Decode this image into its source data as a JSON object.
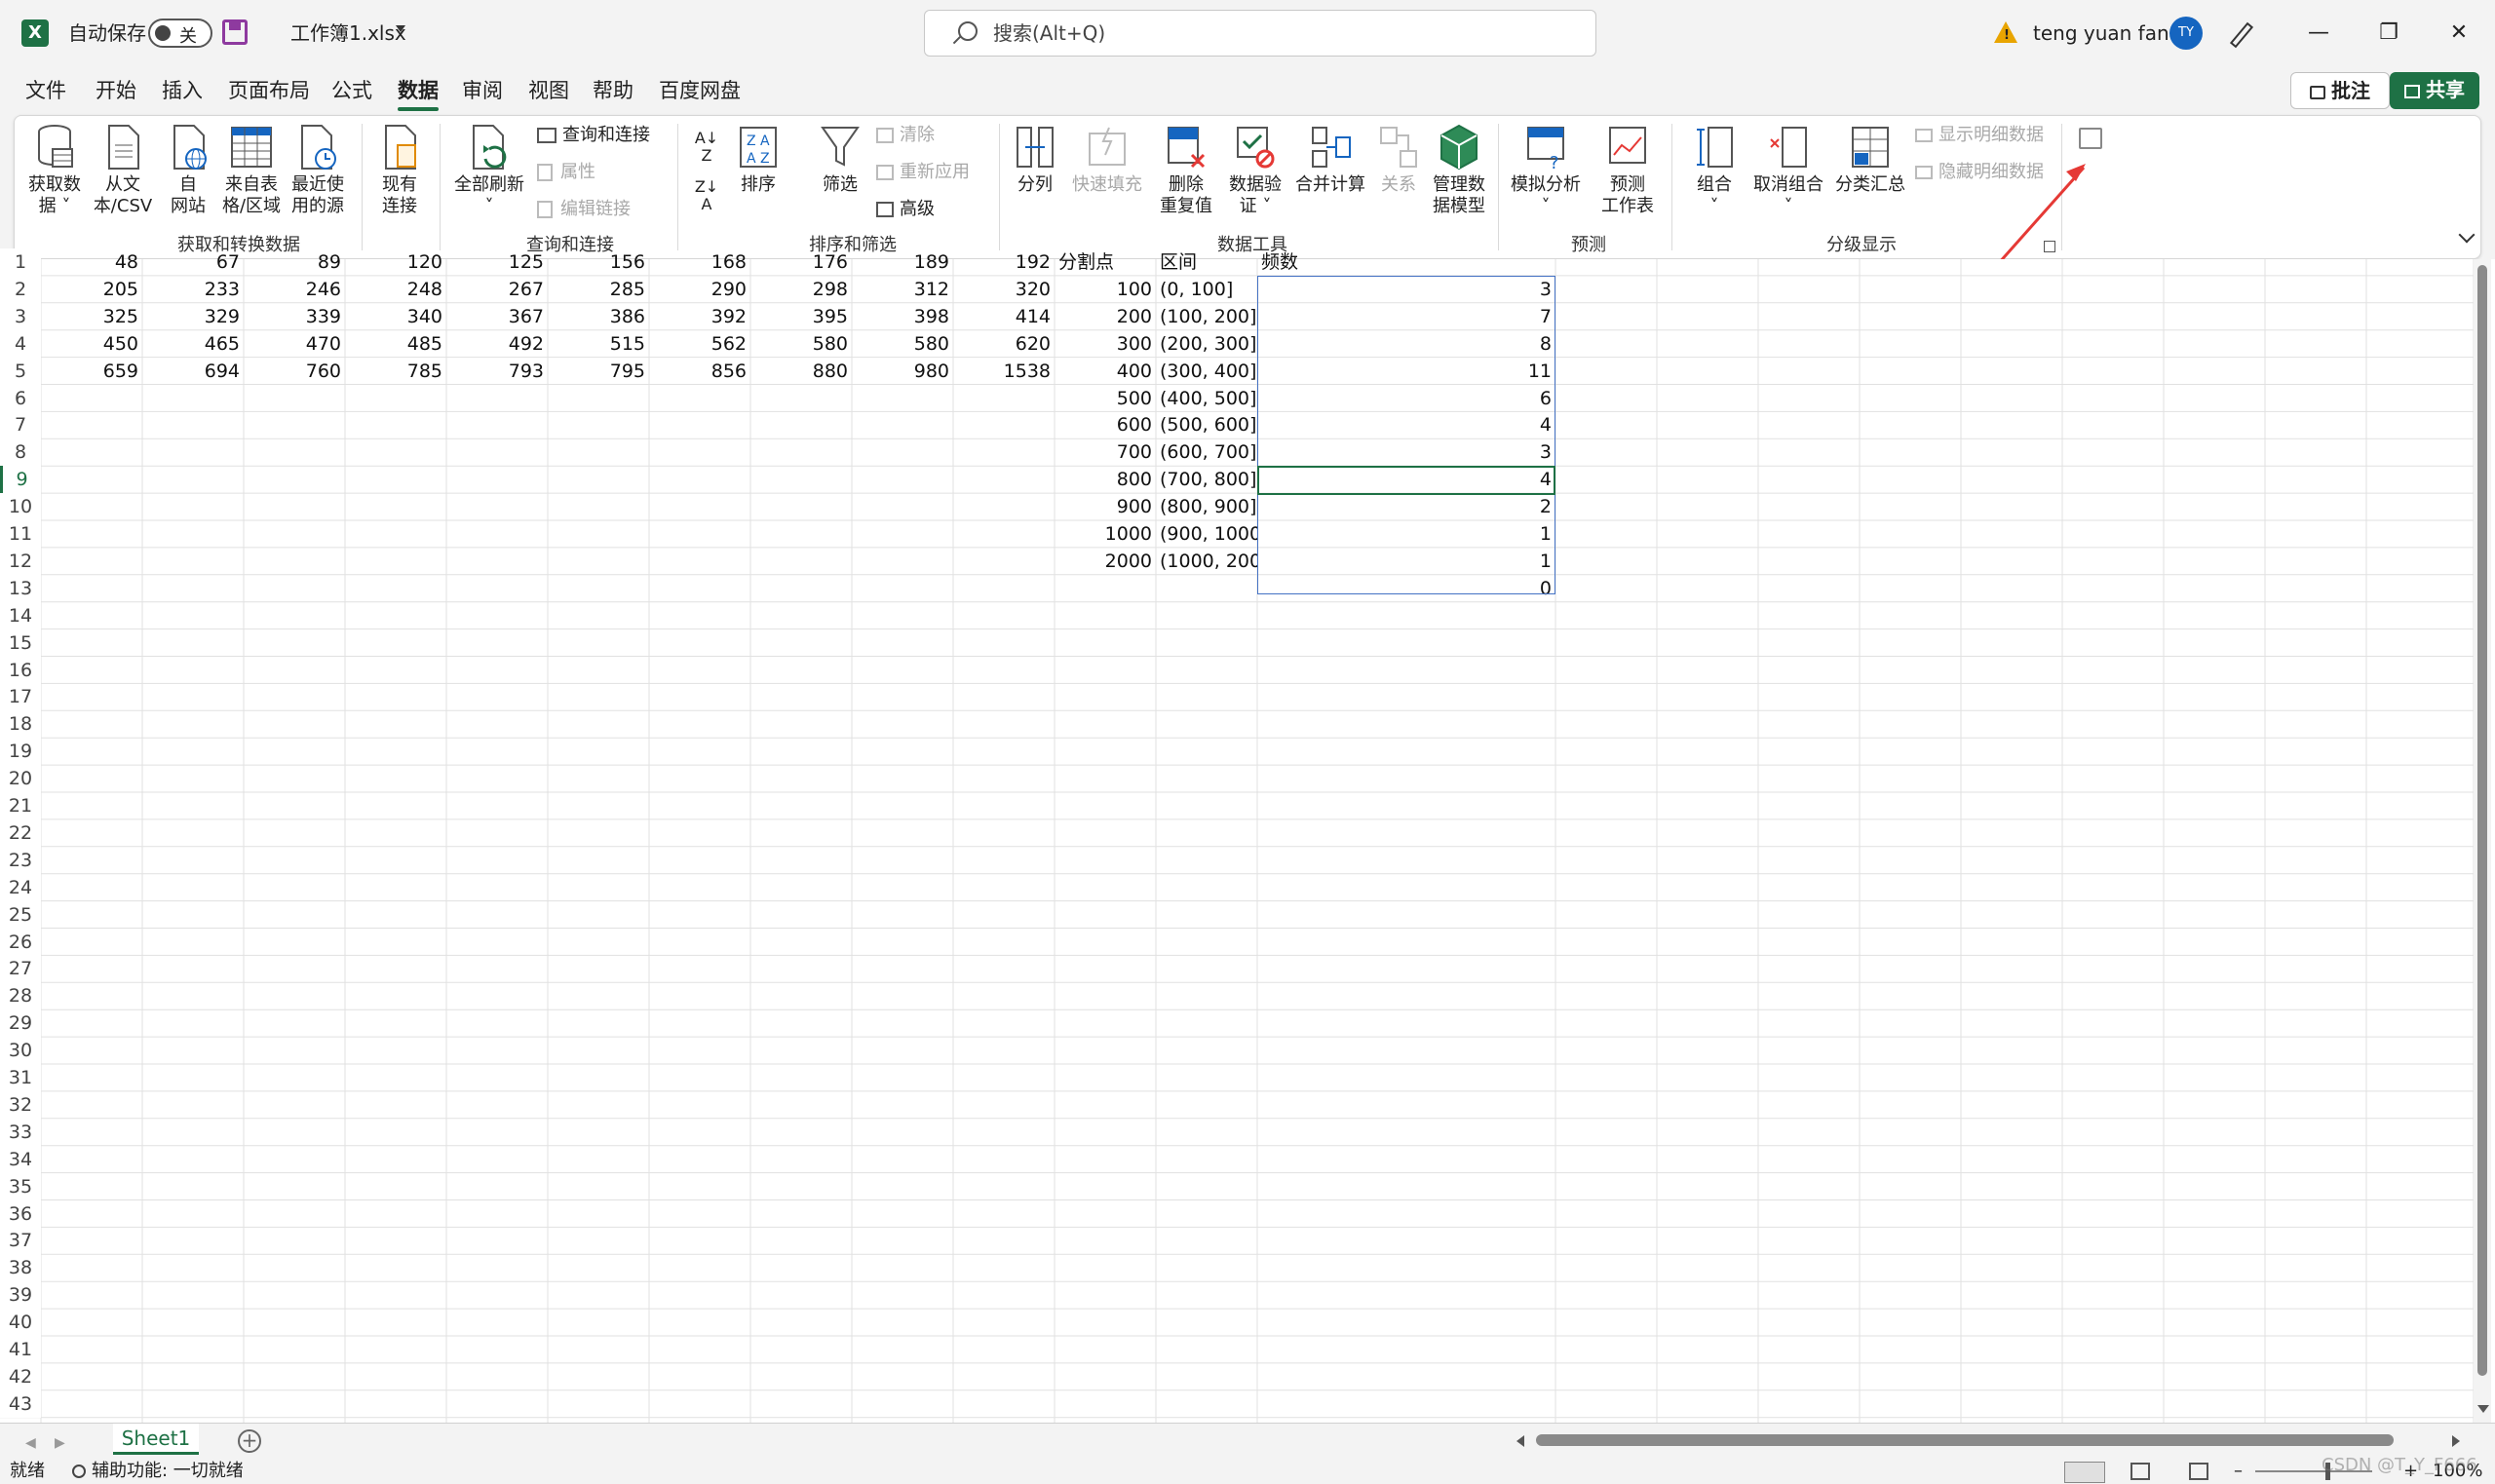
{
  "title_bar": {
    "autosave_label": "自动保存",
    "autosave_state": "关",
    "file_name": "工作簿1.xlsx",
    "search_placeholder": "搜索(Alt+Q)",
    "user_name": "teng yuan fan",
    "user_initials": "TY",
    "app_icon": "excel-logo-icon"
  },
  "menu": {
    "items": [
      "文件",
      "开始",
      "插入",
      "页面布局",
      "公式",
      "数据",
      "审阅",
      "视图",
      "帮助",
      "百度网盘"
    ],
    "active": "数据",
    "comments_label": "批注",
    "share_label": "共享"
  },
  "ribbon": {
    "get_data": {
      "label1": "获取数",
      "label2": "据"
    },
    "from_text": {
      "label1": "从文",
      "label2": "本/CSV"
    },
    "from_web": {
      "label1": "自",
      "label2": "网站"
    },
    "from_table": {
      "label1": "来自表",
      "label2": "格/区域"
    },
    "recent_sources": {
      "label1": "最近使",
      "label2": "用的源"
    },
    "existing_conn": {
      "label1": "现有",
      "label2": "连接"
    },
    "group_get_transform": "获取和转换数据",
    "refresh_all": {
      "label1": "全部刷新"
    },
    "queries_connections": "查询和连接",
    "properties": "属性",
    "edit_links": "编辑链接",
    "group_queries": "查询和连接",
    "sort": "排序",
    "filter": "筛选",
    "clear": "清除",
    "reapply": "重新应用",
    "advanced": "高级",
    "group_sort_filter": "排序和筛选",
    "text_to_columns": "分列",
    "flash_fill": "快速填充",
    "remove_dup": {
      "label1": "删除",
      "label2": "重复值"
    },
    "data_validation": {
      "label1": "数据验",
      "label2": "证"
    },
    "consolidate": "合并计算",
    "relationships": "关系",
    "data_model": {
      "label1": "管理数",
      "label2": "据模型"
    },
    "group_data_tools": "数据工具",
    "what_if": "模拟分析",
    "forecast_sheet": {
      "label1": "预测",
      "label2": "工作表"
    },
    "group_forecast": "预测",
    "group_btn": "组合",
    "ungroup_btn": "取消组合",
    "subtotal": "分类汇总",
    "show_detail": "显示明细数据",
    "hide_detail": "隐藏明细数据",
    "group_outline": "分级显示"
  },
  "sheet": {
    "row_numbers": [
      "1",
      "2",
      "3",
      "4",
      "5",
      "6",
      "7",
      "8",
      "9",
      "10",
      "11",
      "12",
      "13",
      "14",
      "15",
      "16",
      "17",
      "18",
      "19",
      "20",
      "21",
      "22",
      "23",
      "24",
      "25",
      "26",
      "27",
      "28",
      "29",
      "30",
      "31",
      "32",
      "33",
      "34",
      "35",
      "36",
      "37",
      "38",
      "39",
      "40",
      "41",
      "42",
      "43"
    ],
    "row1": [
      "48",
      "67",
      "89",
      "120",
      "125",
      "156",
      "168",
      "176",
      "189",
      "192",
      "分割点",
      "区间",
      "频数"
    ],
    "data_rows": [
      [
        "205",
        "233",
        "246",
        "248",
        "267",
        "285",
        "290",
        "298",
        "312",
        "320"
      ],
      [
        "325",
        "329",
        "339",
        "340",
        "367",
        "386",
        "392",
        "395",
        "398",
        "414"
      ],
      [
        "450",
        "465",
        "470",
        "485",
        "492",
        "515",
        "562",
        "580",
        "580",
        "620"
      ],
      [
        "659",
        "694",
        "760",
        "785",
        "793",
        "795",
        "856",
        "880",
        "980",
        "1538"
      ]
    ],
    "split_points": [
      "100",
      "200",
      "300",
      "400",
      "500",
      "600",
      "700",
      "800",
      "900",
      "1000",
      "2000"
    ],
    "intervals": [
      "(0, 100]",
      "(100, 200]",
      "(200, 300]",
      "(300, 400]",
      "(400, 500]",
      "(500, 600]",
      "(600, 700]",
      "(700, 800]",
      "(800, 900]",
      "(900, 1000",
      "(1000, 200"
    ],
    "frequencies": [
      "3",
      "7",
      "8",
      "11",
      "6",
      "4",
      "3",
      "4",
      "2",
      "1",
      "1",
      "0"
    ]
  },
  "sheet_tabs": {
    "active": "Sheet1"
  },
  "status": {
    "ready": "就绪",
    "accessibility": "辅助功能: 一切就绪",
    "zoom": "100%",
    "watermark": "CSDN @T_Y_F666"
  },
  "colors": {
    "accent": "#1e7145",
    "selection": "#4472c4",
    "annotation_arrow": "#e53935"
  }
}
